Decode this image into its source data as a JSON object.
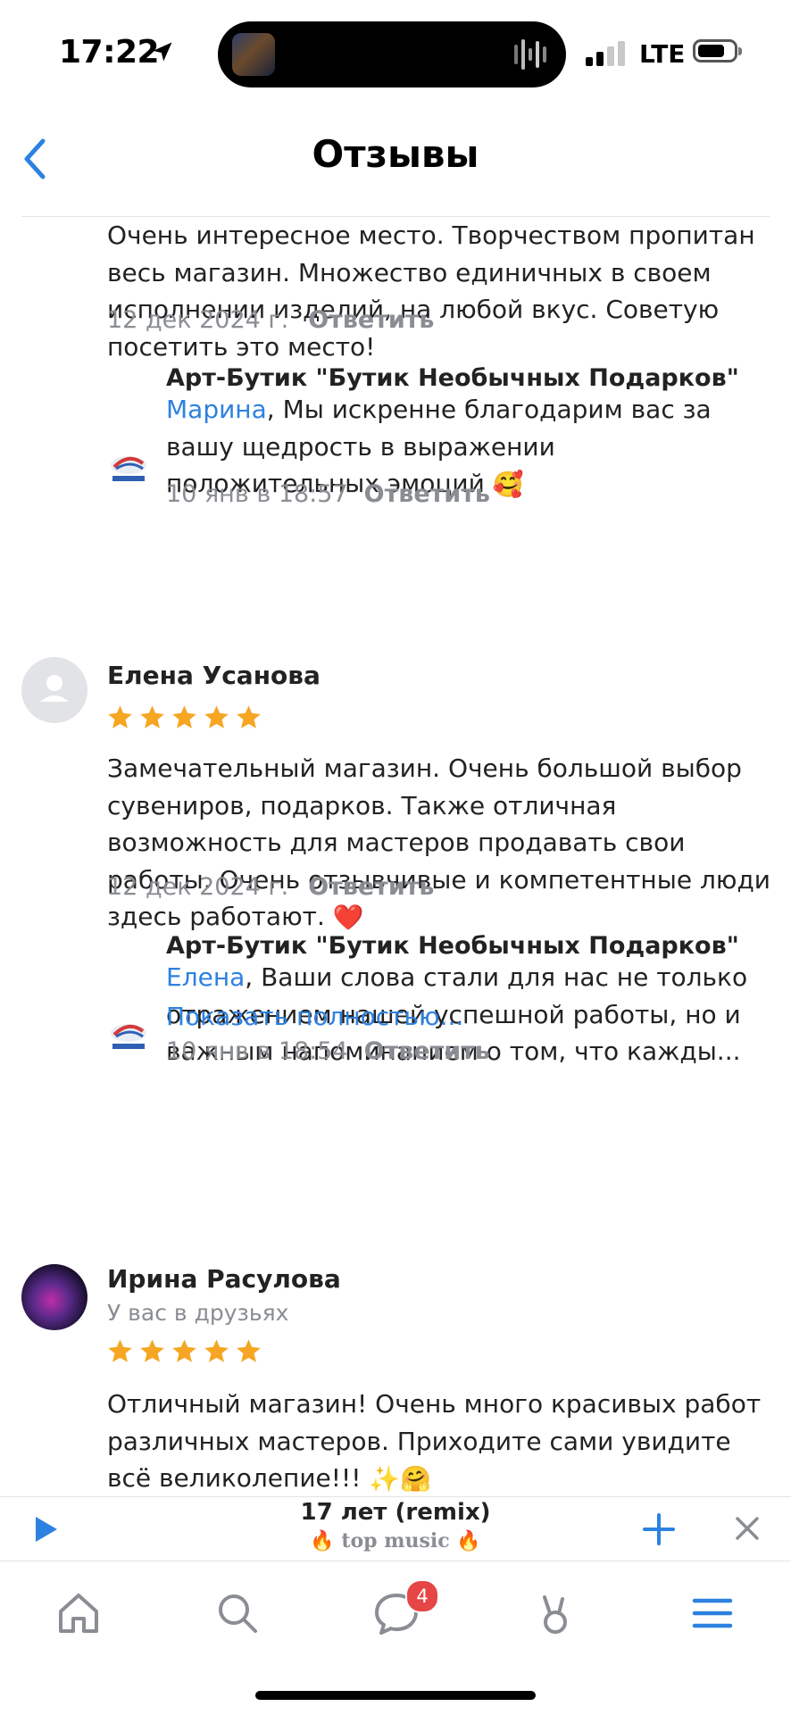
{
  "status": {
    "time": "17:22",
    "network": "LTE"
  },
  "header": {
    "title": "Отзывы"
  },
  "review1": {
    "text": "Очень интересное место. Творчеством пропитан весь магазин. Множество единичных в своем исполнении изделий, на любой вкус. Советую посетить это место!",
    "date": "12 дек 2024 г.",
    "reply_label": "Ответить",
    "owner_reply": {
      "author": "Арт-Бутик \"Бутик Необычных Подарков\"",
      "mention": "Марина",
      "text": ", Мы искренне благодарим вас за вашу щедрость в выражении положительных эмоций",
      "emoji": "🥰",
      "date": "10 янв в 18:57",
      "reply_label": "Ответить"
    }
  },
  "review2": {
    "author": "Елена Усанова",
    "rating": 5,
    "text": "Замечательный магазин. Очень большой выбор сувениров, подарков. Также отличная возможность для мастеров продавать свои работы. Очень отзывчивые и компетентные люди здесь работают.",
    "emoji": "❤️",
    "date": "12 дек 2024 г.",
    "reply_label": "Ответить",
    "owner_reply": {
      "author": "Арт-Бутик \"Бутик Необычных Подарков\"",
      "mention": "Елена",
      "text": ", Ваши слова стали для нас не только отражением нашей успешной работы, но и важным напоминанием о том, что кажды...",
      "show_more": "Показать полностью...",
      "date": "10 янв в 18:54",
      "reply_label": "Ответить"
    }
  },
  "review3": {
    "author": "Ирина Расулова",
    "subtitle": "У вас в друзьях",
    "rating": 5,
    "text": "Отличный магазин! Очень много красивых работ различных мастеров. Приходите сами увидите всё великолепие!!!",
    "emoji": "✨🤗"
  },
  "player": {
    "track": "17 лет (remix)",
    "artist": "🔥 top music 🔥"
  },
  "tabbar": {
    "messages_badge": "4"
  },
  "colors": {
    "accent": "#2d81e0",
    "star": "#f5a623",
    "badge": "#e64646",
    "secondary_text": "#8a8d93"
  },
  "icons": [
    "back-chevron-icon",
    "play-icon",
    "plus-icon",
    "close-icon",
    "home-icon",
    "search-icon",
    "messages-icon",
    "clips-icon",
    "menu-icon"
  ]
}
